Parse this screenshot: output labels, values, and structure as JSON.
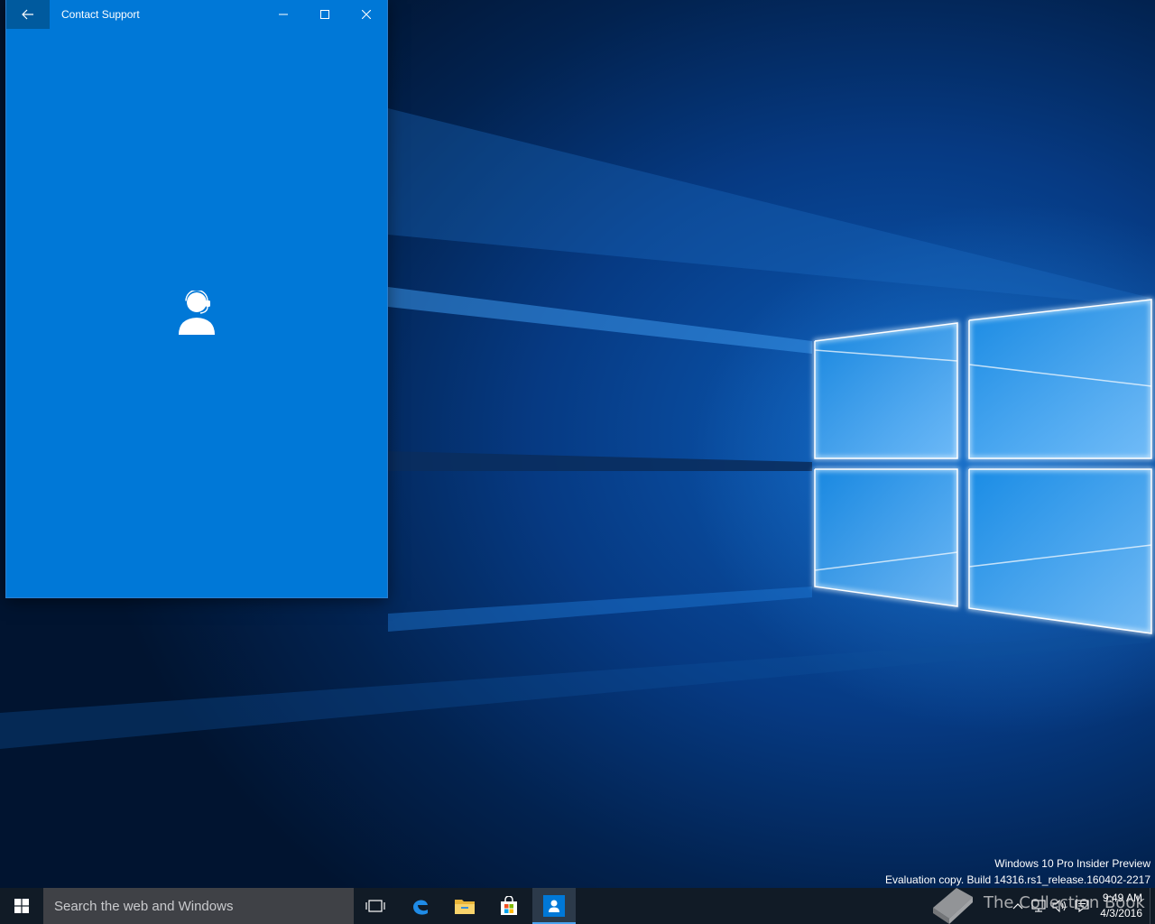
{
  "window": {
    "title": "Contact Support",
    "back_icon": "arrow-left-icon",
    "minimize_icon": "minimize-icon",
    "maximize_icon": "maximize-icon",
    "close_icon": "close-icon",
    "accent_color": "#0078d7",
    "content_icon": "support-agent-icon"
  },
  "desktop": {
    "watermark_line1": "Windows 10 Pro Insider Preview",
    "watermark_line2": "Evaluation copy. Build 14316.rs1_release.160402-2217"
  },
  "taskbar": {
    "search_placeholder": "Search the web and Windows",
    "apps": [
      {
        "name": "Task View",
        "icon": "task-view-icon"
      },
      {
        "name": "Microsoft Edge",
        "icon": "edge-icon"
      },
      {
        "name": "File Explorer",
        "icon": "folder-icon"
      },
      {
        "name": "Store",
        "icon": "store-icon"
      },
      {
        "name": "Contact Support",
        "icon": "contact-support-icon",
        "active": true
      }
    ],
    "tray": {
      "time": "9:49 AM",
      "date": "4/3/2016"
    },
    "overlay_logo_text": "The Collection Book"
  }
}
